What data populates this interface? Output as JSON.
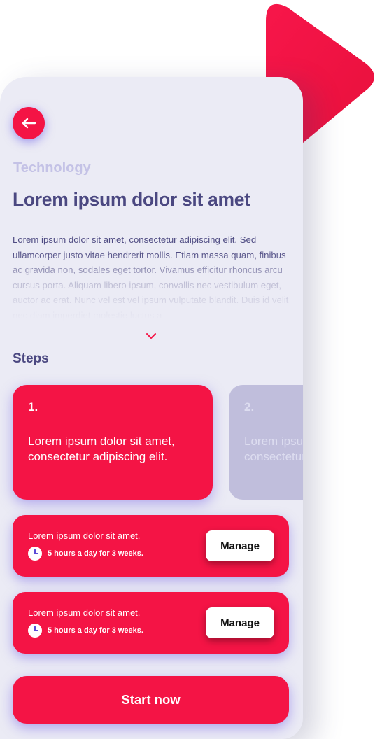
{
  "header": {
    "back_icon": "arrow-left-icon",
    "category": "Technology",
    "title": "Lorem ipsum dolor sit amet"
  },
  "article": {
    "body": "Lorem ipsum dolor sit amet, consectetur adipiscing elit. Sed ullamcorper justo vitae hendrerit mollis. Etiam massa quam, finibus ac gravida non, sodales eget tortor. Vivamus efficitur rhoncus arcu cursus porta. Aliquam libero ipsum, convallis nec vestibulum eget, auctor ac erat. Nunc vel est vel ipsum vulputate blandit. Duis id velit nec diam imperdiet molestie luctus a",
    "expand_icon": "chevron-down-icon"
  },
  "steps": {
    "heading": "Steps",
    "items": [
      {
        "number": "1.",
        "text": "Lorem ipsum dolor sit amet, consectetur adipiscing elit."
      },
      {
        "number": "2.",
        "text": "Lorem ipsum dolor sit amet, consectetur adipiscing elit."
      }
    ]
  },
  "tasks": [
    {
      "title": "Lorem ipsum dolor sit amet.",
      "meta": "5 hours a day for 3 weeks.",
      "icon": "clock-icon",
      "button": "Manage"
    },
    {
      "title": "Lorem ipsum dolor sit amet.",
      "meta": "5 hours a day for 3 weeks.",
      "icon": "clock-icon",
      "button": "Manage"
    }
  ],
  "cta": {
    "label": "Start now"
  },
  "colors": {
    "accent": "#f41445",
    "background": "#ebebf5",
    "heading": "#4b4881",
    "muted": "#c4c2e6",
    "inactive_card": "#c0bedc",
    "shadow_glow": "#7864e6"
  }
}
